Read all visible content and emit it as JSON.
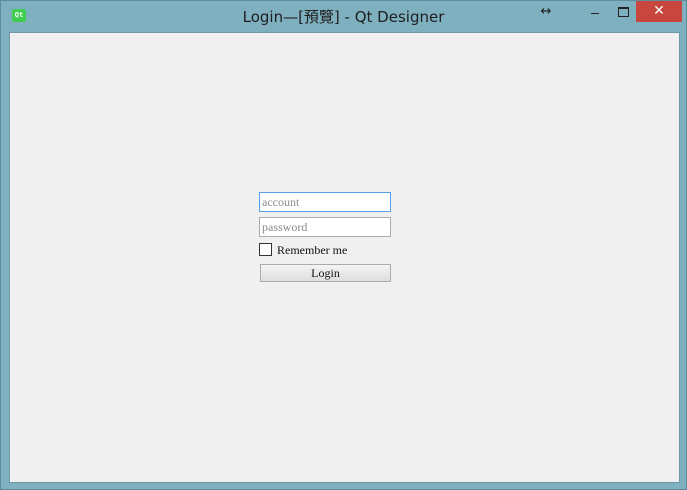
{
  "window": {
    "title": "Login—[預覽] - Qt Designer",
    "app_icon_text": "Qt",
    "controls": {
      "resize": "↔",
      "close": "✕"
    }
  },
  "form": {
    "account": {
      "value": "",
      "placeholder": "account"
    },
    "password": {
      "value": "",
      "placeholder": "password"
    },
    "remember": {
      "label": "Remember me",
      "checked": false
    },
    "login_label": "Login"
  },
  "colors": {
    "frame": "#7eb0c0",
    "client_bg": "#f0f0f0",
    "close_button": "#c7463d",
    "focus_border": "#569de5"
  }
}
